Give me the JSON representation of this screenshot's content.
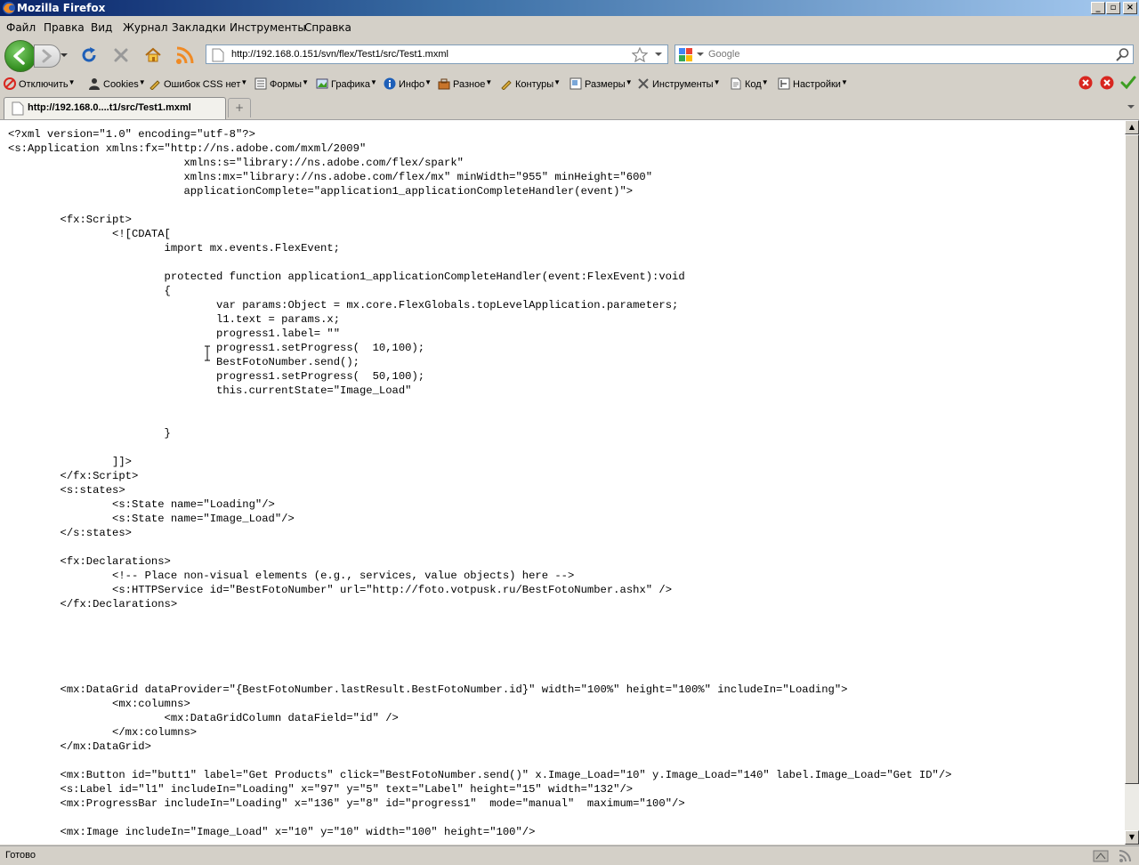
{
  "window": {
    "title": "Mozilla Firefox",
    "controls": [
      "_",
      "▫",
      "×"
    ]
  },
  "menu": [
    "Файл",
    "Правка",
    "Вид",
    "Журнал",
    "Закладки",
    "Инструменты",
    "Справка"
  ],
  "nav": {
    "url": "http://192.168.0.151/svn/flex/Test1/src/Test1.mxml",
    "search_placeholder": "Google"
  },
  "devtoolbar": {
    "items": [
      "Отключить",
      "Cookies",
      "Ошибок CSS нет",
      "Формы",
      "Графика",
      "Инфо",
      "Разное",
      "Контуры",
      "Размеры",
      "Инструменты",
      "Код",
      "Настройки"
    ]
  },
  "tab": {
    "title": "http://192.168.0....t1/src/Test1.mxml",
    "new_tab": "+"
  },
  "document": {
    "code": "<?xml version=\"1.0\" encoding=\"utf-8\"?>\n<s:Application xmlns:fx=\"http://ns.adobe.com/mxml/2009\"\n\t\t\t   xmlns:s=\"library://ns.adobe.com/flex/spark\"\n\t\t\t   xmlns:mx=\"library://ns.adobe.com/flex/mx\" minWidth=\"955\" minHeight=\"600\"\n\t\t\t   applicationComplete=\"application1_applicationCompleteHandler(event)\">\n\n\t<fx:Script>\n\t\t<![CDATA[\n\t\t\timport mx.events.FlexEvent;\n\n\t\t\tprotected function application1_applicationCompleteHandler(event:FlexEvent):void\n\t\t\t{\n\t\t\t\tvar params:Object = mx.core.FlexGlobals.topLevelApplication.parameters;\n\t\t\t\tl1.text = params.x;\n\t\t\t\tprogress1.label= \"\"\n\t\t\t\tprogress1.setProgress(  10,100);\n\t\t\t\tBestFotoNumber.send();\n\t\t\t\tprogress1.setProgress(  50,100);\n\t\t\t\tthis.currentState=\"Image_Load\"\n\n\n\t\t\t}\n\n\t\t]]>\n\t</fx:Script>\n\t<s:states>\n\t\t<s:State name=\"Loading\"/>\n\t\t<s:State name=\"Image_Load\"/>\n\t</s:states>\n\n\t<fx:Declarations>\n\t\t<!-- Place non-visual elements (e.g., services, value objects) here -->\n\t\t<s:HTTPService id=\"BestFotoNumber\" url=\"http://foto.votpusk.ru/BestFotoNumber.ashx\" />\n\t</fx:Declarations>\n\n\n\n\n\n\t<mx:DataGrid dataProvider=\"{BestFotoNumber.lastResult.BestFotoNumber.id}\" width=\"100%\" height=\"100%\" includeIn=\"Loading\">\n\t\t<mx:columns>\n\t\t\t<mx:DataGridColumn dataField=\"id\" />\n\t\t</mx:columns>\n\t</mx:DataGrid>\n\n\t<mx:Button id=\"butt1\" label=\"Get Products\" click=\"BestFotoNumber.send()\" x.Image_Load=\"10\" y.Image_Load=\"140\" label.Image_Load=\"Get ID\"/>\n\t<s:Label id=\"l1\" includeIn=\"Loading\" x=\"97\" y=\"5\" text=\"Label\" height=\"15\" width=\"132\"/>\n\t<mx:ProgressBar includeIn=\"Loading\" x=\"136\" y=\"8\" id=\"progress1\"  mode=\"manual\"  maximum=\"100\"/>\n\n\t<mx:Image includeIn=\"Image_Load\" x=\"10\" y=\"10\" width=\"100\" height=\"100\"/>"
  },
  "status": {
    "text": "Готово"
  },
  "colors": {
    "titlebar_start": "#0a246a",
    "titlebar_end": "#a6caf0",
    "chrome": "#d4d0c8",
    "back_green": "#2f8a1c",
    "reload_blue": "#1e5fb8",
    "rss_orange": "#f08a24",
    "red_icon": "#d8261f",
    "check_green": "#3d9e22"
  }
}
